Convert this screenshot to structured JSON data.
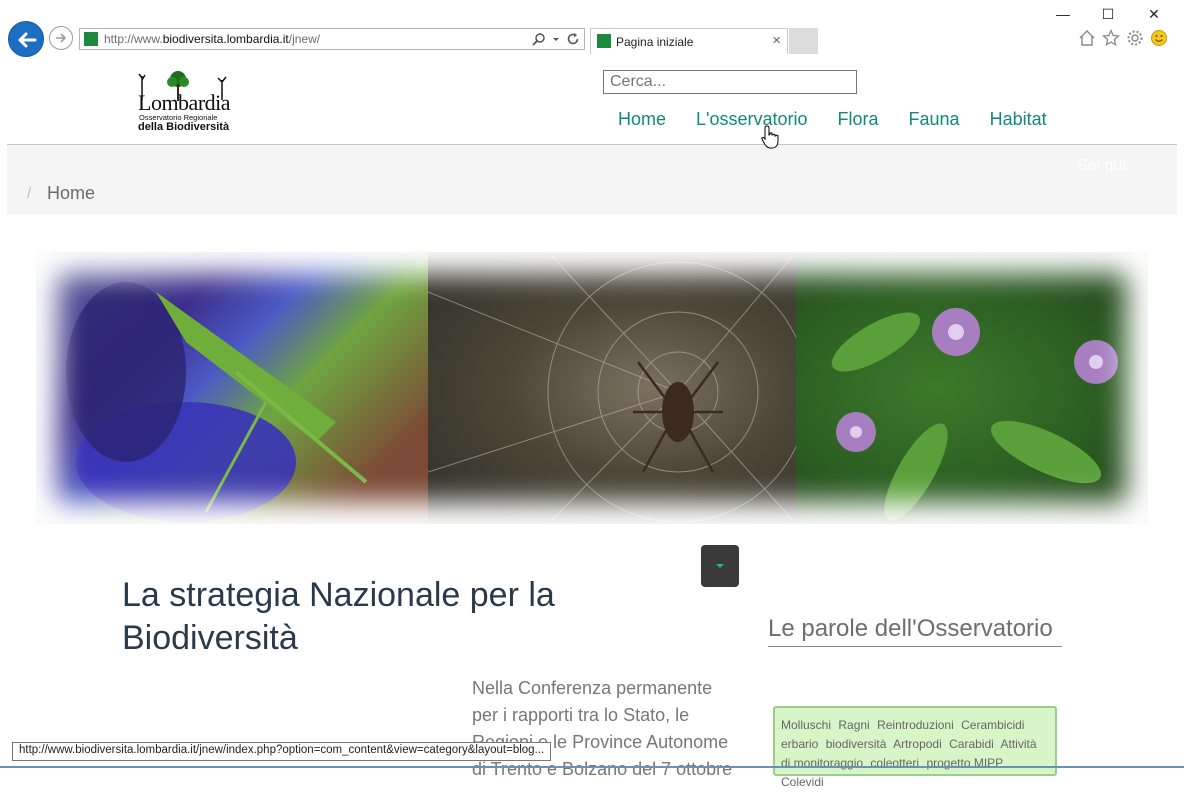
{
  "browser": {
    "url_prefix": "http://www.",
    "url_host": "biodiversita.lombardia.it",
    "url_path": "/jnew/",
    "tab_title": "Pagina iniziale",
    "tab_close": "×",
    "minimize": "—",
    "maximize": "☐",
    "close": "✕",
    "status_url": "http://www.biodiversita.lombardia.it/jnew/index.php?option=com_content&view=category&layout=blog..."
  },
  "header": {
    "logo_main": "Lombardia",
    "logo_sub1": "Osservatorio Regionale",
    "logo_sub2": "della Biodiversità",
    "search_placeholder": "Cerca...",
    "nav": [
      "Home",
      "L'osservatorio",
      "Flora",
      "Fauna",
      "Habitat"
    ]
  },
  "breadcrumb": {
    "label": "Sei qui:",
    "separator": "/",
    "current": "Home"
  },
  "article": {
    "title": "La strategia Nazionale per la Biodiversità",
    "body": "Nella Conferenza permanente per i rapporti tra lo Stato, le Regioni e le Province Autonome di Trento e Bolzano del 7 ottobre"
  },
  "sidebar": {
    "title": "Le parole dell'Osservatorio",
    "tags": [
      "Molluschi",
      "Ragni",
      "Reintroduzioni",
      "Cerambicidi",
      "erbario",
      "biodiversità",
      "Artropodi",
      "Carabidi",
      "Attività di monitoraggio",
      "coleotteri",
      "progetto MIPP",
      "Colevidi"
    ]
  },
  "colors": {
    "nav_link": "#0f8a79",
    "accent_caret": "#1ab39d",
    "tags_bg": "#d7f5c6",
    "back_button": "#1b6ec2"
  }
}
